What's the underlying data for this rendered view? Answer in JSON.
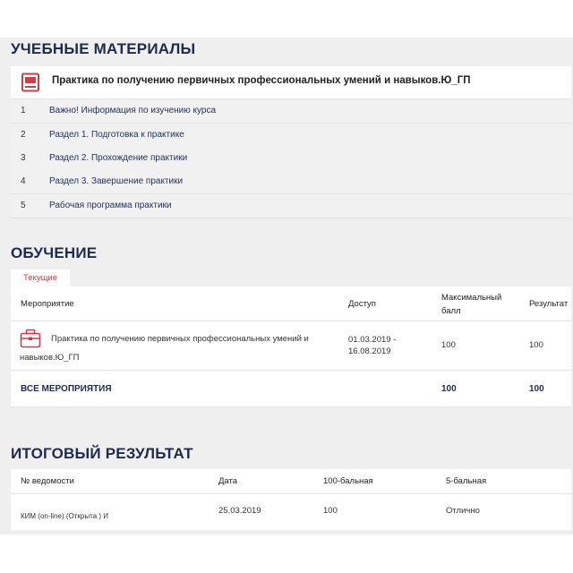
{
  "materials": {
    "title": "УЧЕБНЫЕ МАТЕРИАЛЫ",
    "course_title": "Практика по получению первичных профессиональных умений и навыков.Ю_ГП",
    "items": [
      {
        "num": "1",
        "label": "Важно! Информация по изучению курса"
      },
      {
        "num": "2",
        "label": "Раздел 1. Подготовка к практике"
      },
      {
        "num": "3",
        "label": "Раздел 2. Прохождение практики"
      },
      {
        "num": "4",
        "label": "Раздел 3. Завершение практики"
      },
      {
        "num": "5",
        "label": "Рабочая программа практики"
      }
    ]
  },
  "training": {
    "title": "ОБУЧЕНИЕ",
    "tab": "Текущие",
    "columns": {
      "event": "Мероприятие",
      "access": "Доступ",
      "max_score_1": "Максимальный",
      "max_score_2": "балл",
      "result": "Результат"
    },
    "row": {
      "event_line1": "Практика по получению первичных профессиональных умений и",
      "event_line2": "навыков.Ю_ГП",
      "access_line1": "01.03.2019 -",
      "access_line2": "16.08.2019",
      "max_score": "100",
      "result": "100"
    },
    "total": {
      "label": "ВСЕ МЕРОПРИЯТИЯ",
      "max_score": "100",
      "result": "100"
    }
  },
  "final": {
    "title": "ИТОГОВЫЙ РЕЗУЛЬТАТ",
    "columns": {
      "sheet": "№ ведомости",
      "date": "Дата",
      "score100": "100-бальная",
      "score5": "5-бальная"
    },
    "row": {
      "sheet": "КИМ (on-line) (Открыта ) И",
      "date": "25.03.2019",
      "score100": "100",
      "score5": "Отлично"
    }
  },
  "colors": {
    "accent": "#c8404a",
    "heading": "#1f2b4d",
    "background": "#efefef"
  }
}
